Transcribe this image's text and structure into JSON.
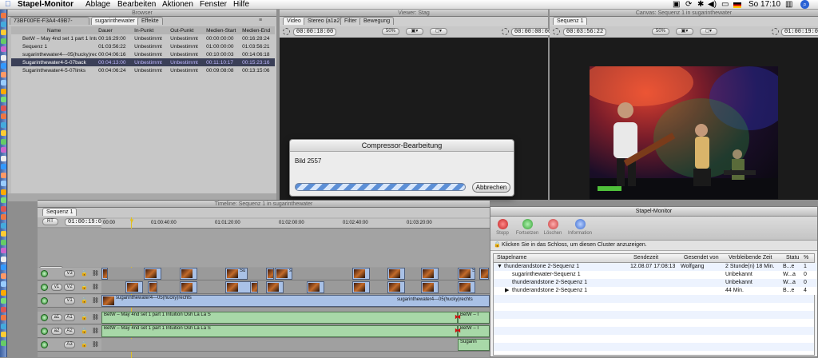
{
  "menubar": {
    "app": "Stapel-Monitor",
    "items": [
      "Ablage",
      "Bearbeiten",
      "Aktionen",
      "Fenster",
      "Hilfe"
    ],
    "clock": "So 17:10"
  },
  "browser": {
    "title": "Browser",
    "tabs": [
      "73BF00FE-F3A4-49B7-83F1-85",
      "sugarinthewater",
      "Effekte"
    ],
    "columns": [
      "Name",
      "Dauer",
      "In-Punkt",
      "Out-Punkt",
      "Medien-Start",
      "Medien-End"
    ],
    "rows": [
      {
        "name": "BetW – May 4nd set 1 part 1 Intuition",
        "dur": "00:16:29:00",
        "in": "Unbestimmt",
        "out": "Unbestimmt",
        "ms": "00:00:00:00",
        "me": "00:16:28:24",
        "sel": false
      },
      {
        "name": "Sequenz 1",
        "dur": "01:03:56:22",
        "in": "Unbestimmt",
        "out": "Unbestimmt",
        "ms": "01:00:00:00",
        "me": "01:03:56:21",
        "sel": false
      },
      {
        "name": "sugarinthewater4---05(hucky)rechts",
        "dur": "00:04:06:16",
        "in": "Unbestimmt",
        "out": "Unbestimmt",
        "ms": "00:10:00:03",
        "me": "00:14:06:18",
        "sel": false
      },
      {
        "name": "Sugarinthewater4-5-07back",
        "dur": "00:04:13:00",
        "in": "Unbestimmt",
        "out": "Unbestimmt",
        "ms": "00:11:10:17",
        "me": "00:15:23:16",
        "sel": true
      },
      {
        "name": "Sugarinthewater4-5-07links",
        "dur": "00:04:06:24",
        "in": "Unbestimmt",
        "out": "Unbestimmt",
        "ms": "00:09:08:08",
        "me": "00:13:15:06",
        "sel": false
      }
    ]
  },
  "viewer": {
    "title": "Viewer: Stag",
    "tabs": [
      "Video",
      "Stereo (a1a2)",
      "Filter",
      "Bewegung"
    ],
    "tc_left": "00:00:10:00",
    "tc_right": "00:00:00:00",
    "zoom": "50%"
  },
  "canvas": {
    "title": "Canvas: Sequenz 1 in sugarinthewater",
    "tab": "Sequenz 1",
    "tc_left": "00:03:56:22",
    "tc_right": "01:00:19:00",
    "zoom": "50%"
  },
  "dialog": {
    "title": "Compressor-Bearbeitung",
    "message": "Bild 2557",
    "progress_pct": 100,
    "cancel_label": "Abbrechen"
  },
  "timeline": {
    "title": "Timeline: Sequenz 1 in sugarinthewater",
    "tab": "Sequenz 1",
    "rt": "RT",
    "timecode": "01:00:19:00",
    "ruler": [
      "00:00",
      "01:00:40:00",
      "01:01:20:00",
      "01:02:00:00",
      "01:02:40:00",
      "01:03:20:00"
    ],
    "tracks": [
      {
        "label": "V3",
        "src": ""
      },
      {
        "label": "V2",
        "src": "v1"
      },
      {
        "label": "V1",
        "src": ""
      },
      {
        "label": "A1",
        "src": "a1"
      },
      {
        "label": "A2",
        "src": "a2"
      },
      {
        "label": "A3",
        "src": ""
      }
    ],
    "clips": {
      "v3_a": "Su",
      "v3_b": "sugar",
      "v3_c": "S",
      "v1_left": "sugarinthewater4---05(hucky)rechts",
      "v1_right": "sugarinthewater4---05(hucky)rechts",
      "a1": "BetW – May 4nd set 1 part 1 Intuition Osh La La S",
      "a2": "BetW – May 4nd set 1 part 1 Intuition Osh La La S",
      "a_end1": "BetW – I",
      "a_end2": "BetW – I",
      "a3_end": "Sugarin"
    }
  },
  "stapel": {
    "title": "Stapel-Monitor",
    "toolbar": [
      "Stopp",
      "Fortsetzen",
      "Löschen",
      "Information"
    ],
    "lock_msg": "Klicken Sie in das Schloss, um diesen Cluster anzuzeigen.",
    "columns": [
      "Stapelname",
      "Sendezeit",
      "Gesendet von",
      "Verbleibende Zeit",
      "Statu",
      "%"
    ],
    "rows": [
      {
        "name": "thunderandstone 2-Sequenz 1",
        "time": "12.08.07 17:08:13",
        "by": "Wolfgang",
        "rem": "2 Stunde(n) 18 Min.",
        "st": "B...e",
        "pct": "1",
        "indent": 0,
        "tri": "▼"
      },
      {
        "name": "sugarinthewater-Sequenz 1",
        "time": "",
        "by": "",
        "rem": "Unbekannt",
        "st": "W...a",
        "pct": "0",
        "indent": 1,
        "tri": ""
      },
      {
        "name": "thunderandstone 2-Sequenz 1",
        "time": "",
        "by": "",
        "rem": "Unbekannt",
        "st": "W...a",
        "pct": "0",
        "indent": 1,
        "tri": ""
      },
      {
        "name": "thunderandstone 2-Sequenz 1",
        "time": "",
        "by": "",
        "rem": "44 Min.",
        "st": "B...e",
        "pct": "4",
        "indent": 1,
        "tri": "▶"
      }
    ]
  },
  "colors": {
    "selection": "#3a3f57",
    "progress": "#5c8fd6",
    "video_clip": "#a9c1e6",
    "audio_clip": "#a8d8a8"
  }
}
